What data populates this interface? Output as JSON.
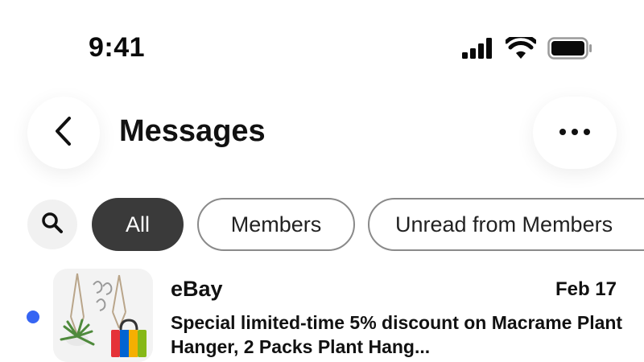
{
  "status_bar": {
    "time": "9:41",
    "icons": [
      "cellular-signal-icon",
      "wifi-icon",
      "battery-icon"
    ]
  },
  "header": {
    "title": "Messages",
    "back_icon": "chevron-left-icon",
    "more_icon": "ellipsis-icon"
  },
  "filters": {
    "search_icon": "search-icon",
    "chips": [
      {
        "label": "All",
        "selected": true
      },
      {
        "label": "Members",
        "selected": false
      },
      {
        "label": "Unread from Members",
        "selected": false
      }
    ]
  },
  "messages": [
    {
      "sender": "eBay",
      "date": "Feb 17",
      "unread": true,
      "preview": "Special limited-time 5% discount on Macrame Plant Hanger, 2 Packs Plant Hang..."
    }
  ],
  "colors": {
    "unread_dot": "#3665f3",
    "selected_chip": "#3a3a3a",
    "chip_border": "#8a8a8a",
    "bag_red": "#e53238",
    "bag_blue": "#0064d2",
    "bag_yellow": "#f5af02",
    "bag_green": "#86b817"
  }
}
